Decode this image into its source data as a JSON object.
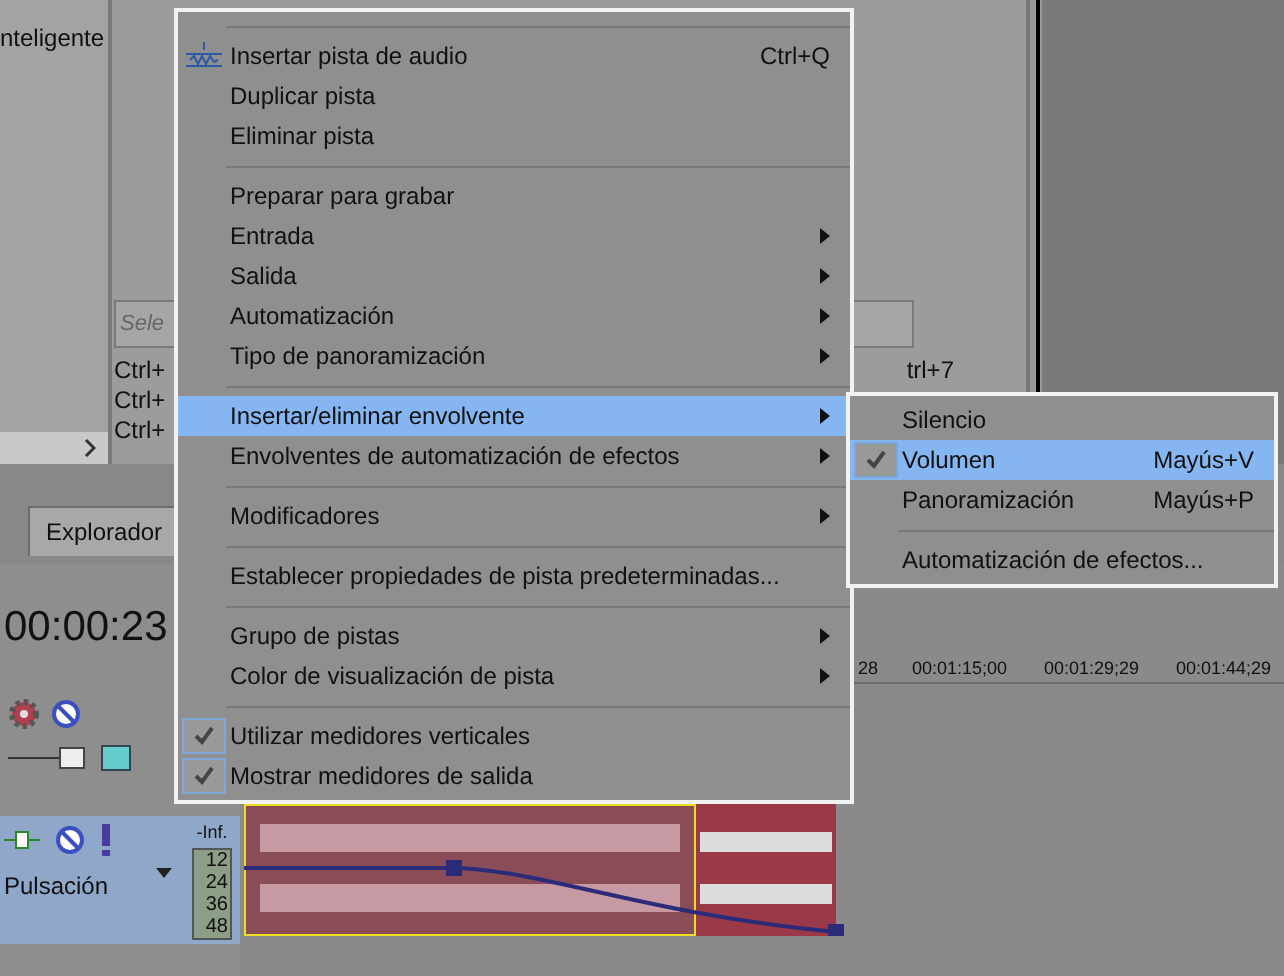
{
  "left_panel": {
    "text": "nteligente"
  },
  "shortcut_panel": {
    "placeholder": "Sele",
    "rows": [
      {
        "left": "Ctrl+",
        "right": "trl+7"
      },
      {
        "left": "Ctrl+",
        "right": ""
      },
      {
        "left": "Ctrl+",
        "right": ""
      }
    ]
  },
  "tabs": [
    {
      "label": "Explorador",
      "selected": true
    }
  ],
  "time_display": "00:00:23",
  "track": {
    "name": "Pulsación",
    "meter_top": "-Inf.",
    "meter_scale": [
      "12",
      "24",
      "36",
      "48"
    ]
  },
  "ruler": [
    "28",
    "00:01:15;00",
    "00:01:29;29",
    "00:01:44;29"
  ],
  "context_menu": {
    "items": [
      {
        "kind": "separator"
      },
      {
        "kind": "item",
        "label": "Insertar pista de audio",
        "shortcut": "Ctrl+Q",
        "submenu": false,
        "checked": false,
        "selected": false,
        "icon": true
      },
      {
        "kind": "item",
        "label": "Duplicar pista",
        "submenu": false,
        "checked": false,
        "selected": false
      },
      {
        "kind": "item",
        "label": "Eliminar pista",
        "submenu": false,
        "checked": false,
        "selected": false
      },
      {
        "kind": "separator"
      },
      {
        "kind": "item",
        "label": "Preparar para grabar",
        "submenu": false,
        "checked": false,
        "selected": false
      },
      {
        "kind": "item",
        "label": "Entrada",
        "submenu": true,
        "checked": false,
        "selected": false
      },
      {
        "kind": "item",
        "label": "Salida",
        "submenu": true,
        "checked": false,
        "selected": false
      },
      {
        "kind": "item",
        "label": "Automatización",
        "submenu": true,
        "checked": false,
        "selected": false
      },
      {
        "kind": "item",
        "label": "Tipo de panoramización",
        "submenu": true,
        "checked": false,
        "selected": false
      },
      {
        "kind": "separator"
      },
      {
        "kind": "item",
        "label": "Insertar/eliminar envolvente",
        "submenu": true,
        "checked": false,
        "selected": true
      },
      {
        "kind": "item",
        "label": "Envolventes de automatización de efectos",
        "submenu": true,
        "checked": false,
        "selected": false
      },
      {
        "kind": "separator"
      },
      {
        "kind": "item",
        "label": "Modificadores",
        "submenu": true,
        "checked": false,
        "selected": false
      },
      {
        "kind": "separator"
      },
      {
        "kind": "item",
        "label": "Establecer propiedades de pista predeterminadas...",
        "submenu": false,
        "checked": false,
        "selected": false
      },
      {
        "kind": "separator"
      },
      {
        "kind": "item",
        "label": "Grupo de pistas",
        "submenu": true,
        "checked": false,
        "selected": false
      },
      {
        "kind": "item",
        "label": "Color de visualización de pista",
        "submenu": true,
        "checked": false,
        "selected": false
      },
      {
        "kind": "separator"
      },
      {
        "kind": "item",
        "label": "Utilizar medidores verticales",
        "submenu": false,
        "checked": true,
        "selected": false
      },
      {
        "kind": "item",
        "label": "Mostrar medidores de salida",
        "submenu": false,
        "checked": true,
        "selected": false
      }
    ]
  },
  "submenu": {
    "items": [
      {
        "kind": "item",
        "label": "Silencio",
        "checked": false,
        "selected": false
      },
      {
        "kind": "item",
        "label": "Volumen",
        "shortcut": "Mayús+V",
        "checked": true,
        "selected": true
      },
      {
        "kind": "item",
        "label": "Panoramización",
        "shortcut": "Mayús+P",
        "checked": false,
        "selected": false
      },
      {
        "kind": "separator"
      },
      {
        "kind": "item",
        "label": "Automatización de efectos...",
        "checked": false,
        "selected": false
      }
    ]
  }
}
